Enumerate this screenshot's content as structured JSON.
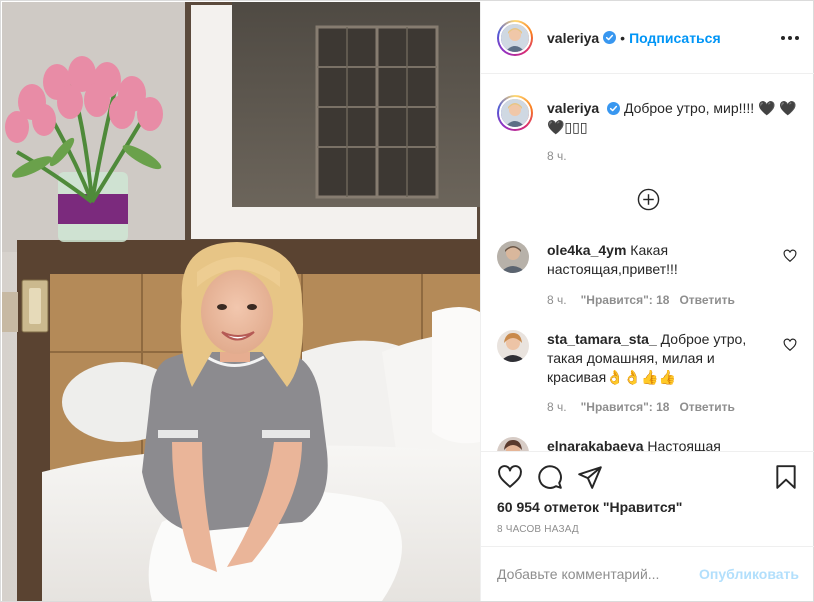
{
  "post": {
    "username": "valeriya",
    "follow_separator": "•",
    "follow_label": "Подписаться"
  },
  "caption": {
    "username": "valeriya",
    "text": "Доброе утро, мир!!!! 🖤 🖤 🖤▯▯▯",
    "time": "8 ч."
  },
  "comments": [
    {
      "username": "ole4ka_4ym",
      "text": "Какая настоящая,привет!!!",
      "time": "8 ч.",
      "likes": "\"Нравится\": 18",
      "reply": "Ответить"
    },
    {
      "username": "sta_tamara_sta_",
      "text": "Доброе утро, такая домашняя, милая и красивая👌👌👍👍",
      "time": "8 ч.",
      "likes": "\"Нравится\": 18",
      "reply": "Ответить"
    },
    {
      "username": "elnarakabaeva",
      "text": "Настоящая"
    }
  ],
  "stats": {
    "likes": "60 954 отметок \"Нравится\"",
    "time_ago": "8 ЧАСОВ НАЗАД"
  },
  "composer": {
    "placeholder": "Добавьте комментарий...",
    "publish_label": "Опубликовать"
  },
  "colors": {
    "accent": "#0095f6",
    "muted": "#8e8e8e",
    "border": "#efefef",
    "publish_disabled": "#b2dffc"
  },
  "icons": [
    "more-options-icon",
    "verified-badge-icon",
    "load-more-icon",
    "heart-outline-icon",
    "comment-bubble-icon",
    "share-plane-icon",
    "bookmark-icon"
  ]
}
